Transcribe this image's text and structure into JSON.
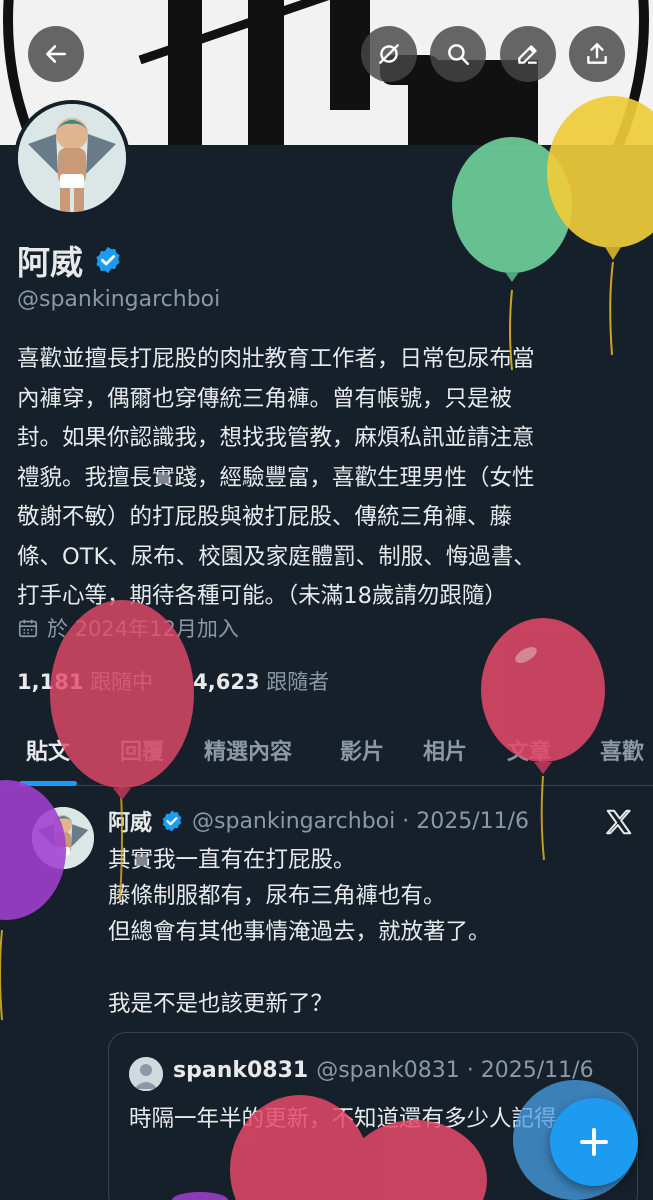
{
  "profile": {
    "display_name": "阿威",
    "handle": "@spankingarchboi",
    "bio": "喜歡並擅長打屁股的肉壯教育工作者，日常包尿布當\n內褲穿，偶爾也穿傳統三角褲。曾有帳號，只是被\n封。如果你認識我，想找我管教，麻煩私訊並請注意\n禮貌。我擅長實踐，經驗豐富，喜歡生理男性（女性\n敬謝不敏）的打屁股與被打屁股、傳統三角褲、藤\n條、OTK、尿布、校園及家庭體罰、制服、悔過書、\n打手心等，期待各種可能。（未滿18歲請勿跟隨）",
    "joined": "於 2024年12月加入",
    "following_count": "1,181",
    "following_label": "跟隨中",
    "followers_count": "4,623",
    "followers_label": "跟隨者"
  },
  "tabs": [
    {
      "label": "貼文",
      "active": true
    },
    {
      "label": "回覆"
    },
    {
      "label": "精選內容"
    },
    {
      "label": "影片"
    },
    {
      "label": "相片"
    },
    {
      "label": "文章"
    },
    {
      "label": "喜歡"
    }
  ],
  "post": {
    "author": "阿威",
    "meta": "@spankingarchboi · 2025/11/6",
    "text": "其實我一直有在打屁股。\n藤條制服都有，尿布三角褲也有。\n但總會有其他事情淹過去，就放著了。\n\n我是不是也該更新了？",
    "quote": {
      "author": "spank0831",
      "meta": "@spank0831 · 2025/11/6",
      "text": "時隔一年半的更新，不知道還有多少人記得"
    }
  },
  "icons": {
    "back": "arrow-left-icon",
    "grok": "grok-icon",
    "search": "search-icon",
    "edit": "pencil-icon",
    "share": "share-icon",
    "verified": "verified-badge-icon",
    "calendar": "calendar-icon",
    "x_logo": "x-logo-icon",
    "compose": "plus-icon"
  },
  "colors": {
    "background": "#15202b",
    "accent": "#1d9bf0",
    "muted": "#8b98a5",
    "text": "#e7e9ea"
  }
}
